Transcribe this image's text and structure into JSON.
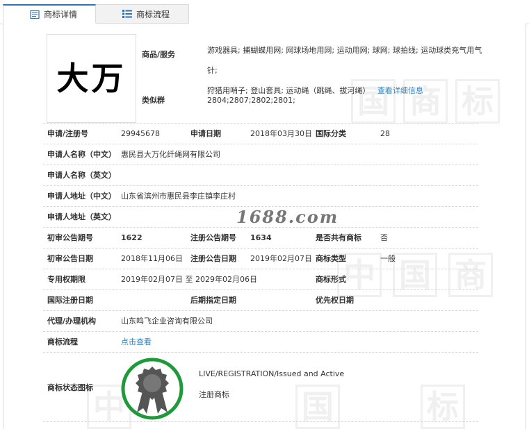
{
  "tabs": [
    {
      "label": "商标详情",
      "icon": "document-icon"
    },
    {
      "label": "商标流程",
      "icon": "list-icon"
    }
  ],
  "logo_text": "大万",
  "goods_services": {
    "label": "商品/服务",
    "line1": "游戏器具; 捕蝴蝶用网; 网球场地用网; 运动用网; 球网; 球拍线; 运动球类充气用气针;",
    "line2": "狩猎用哨子; 登山套具; 运动绳（跳绳、拔河绳）",
    "detail_link": "查看详细信息"
  },
  "similar_group": {
    "label": "类似群",
    "value": "2804;2807;2802;2801;"
  },
  "fields": {
    "reg_no_label": "申请/注册号",
    "reg_no": "29945678",
    "apply_date_label": "申请日期",
    "apply_date": "2018年03月30日",
    "intl_class_label": "国际分类",
    "intl_class": "28",
    "applicant_cn_label": "申请人名称（中文）",
    "applicant_cn": "惠民县大万化纤绳网有限公司",
    "applicant_en_label": "申请人名称（英文）",
    "applicant_en": "",
    "address_cn_label": "申请人地址（中文）",
    "address_cn": "山东省滨州市惠民县李庄镇李庄村",
    "address_en_label": "申请人地址（英文）",
    "address_en": "",
    "prelim_no_label": "初审公告期号",
    "prelim_no": "1622",
    "reg_pub_no_label": "注册公告期号",
    "reg_pub_no": "1634",
    "shared_label": "是否共有商标",
    "shared": "否",
    "prelim_date_label": "初审公告日期",
    "prelim_date": "2018年11月06日",
    "reg_pub_date_label": "注册公告日期",
    "reg_pub_date": "2019年02月07日",
    "type_label": "商标类型",
    "type": "一般",
    "exclusive_label": "专用权期限",
    "exclusive": "2019年02月07日 至 2029年02月06日",
    "form_label": "商标形式",
    "form": "",
    "intl_reg_date_label": "国际注册日期",
    "intl_reg_date": "",
    "later_date_label": "后期指定日期",
    "later_date": "",
    "priority_label": "优先权日期",
    "priority": "",
    "agent_label": "代理/办理机构",
    "agent": "山东鸣飞企业咨询有限公司",
    "flow_label": "商标流程",
    "flow_link": "点击查看",
    "status_label": "商标状态图标",
    "status_en": "LIVE/REGISTRATION/Issued and Active",
    "status_cn": "注册商标"
  },
  "watermark": "1688.com",
  "colors": {
    "accent": "#2f6fb5",
    "link": "#2f85c4",
    "status_ring": "#1f9a3a",
    "medal": "#555555"
  }
}
